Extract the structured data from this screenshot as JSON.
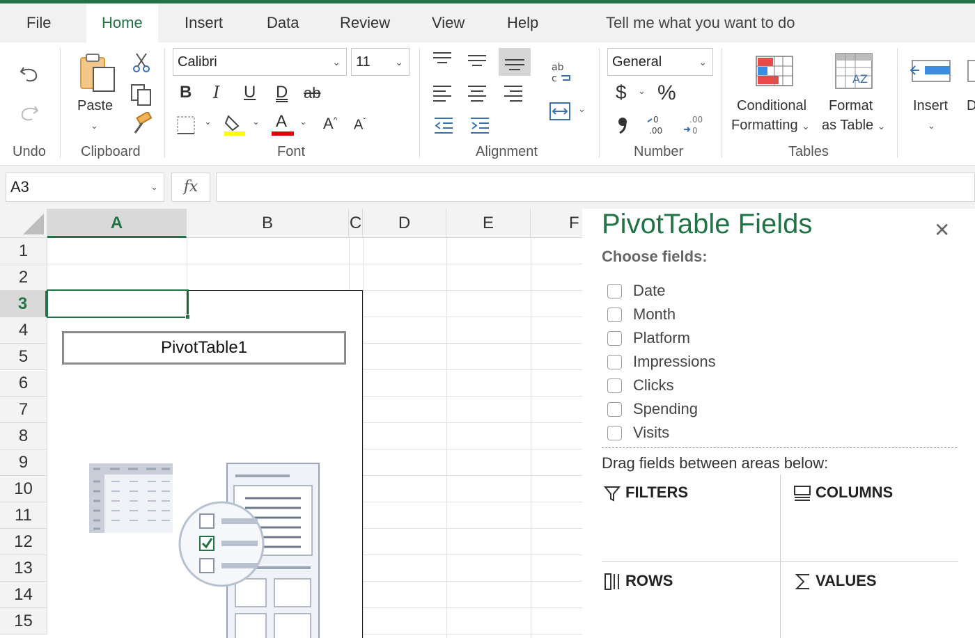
{
  "menu": {
    "tabs": [
      "File",
      "Home",
      "Insert",
      "Data",
      "Review",
      "View",
      "Help"
    ],
    "active": "Home",
    "tell_me": "Tell me what you want to do"
  },
  "ribbon": {
    "undo_group": "Undo",
    "clipboard": {
      "label": "Clipboard",
      "paste": "Paste"
    },
    "font": {
      "label": "Font",
      "name": "Calibri",
      "size": "11",
      "bold": "B",
      "italic": "I",
      "underline": "U",
      "double_underline": "D",
      "strike": "ab",
      "grow": "A",
      "shrink": "A",
      "font_color": "A"
    },
    "alignment": {
      "label": "Alignment"
    },
    "number": {
      "label": "Number",
      "format": "General",
      "currency": "$",
      "percent": "%"
    },
    "tables": {
      "label": "Tables",
      "conditional_line1": "Conditional",
      "conditional_line2": "Formatting",
      "format_line1": "Format",
      "format_line2": "as Table"
    },
    "cells": {
      "insert": "Insert",
      "delete_partial": "D"
    },
    "accent": "#217346"
  },
  "formula_bar": {
    "name_box": "A3",
    "fx": "fx",
    "value": ""
  },
  "grid": {
    "columns": [
      "A",
      "B",
      "C",
      "D",
      "E",
      "F"
    ],
    "selected_column": "A",
    "rows": [
      "1",
      "2",
      "3",
      "4",
      "5",
      "6",
      "7",
      "8",
      "9",
      "10",
      "11",
      "12",
      "13",
      "14",
      "15"
    ],
    "selected_row": "3",
    "pivot_name": "PivotTable1"
  },
  "pivot_pane": {
    "title": "PivotTable Fields",
    "choose_fields": "Choose fields:",
    "fields": [
      "Date",
      "Month",
      "Platform",
      "Impressions",
      "Clicks",
      "Spending",
      "Visits"
    ],
    "drag_text": "Drag fields between areas below:",
    "areas": {
      "filters": "FILTERS",
      "columns": "COLUMNS",
      "rows": "ROWS",
      "values": "VALUES"
    }
  }
}
